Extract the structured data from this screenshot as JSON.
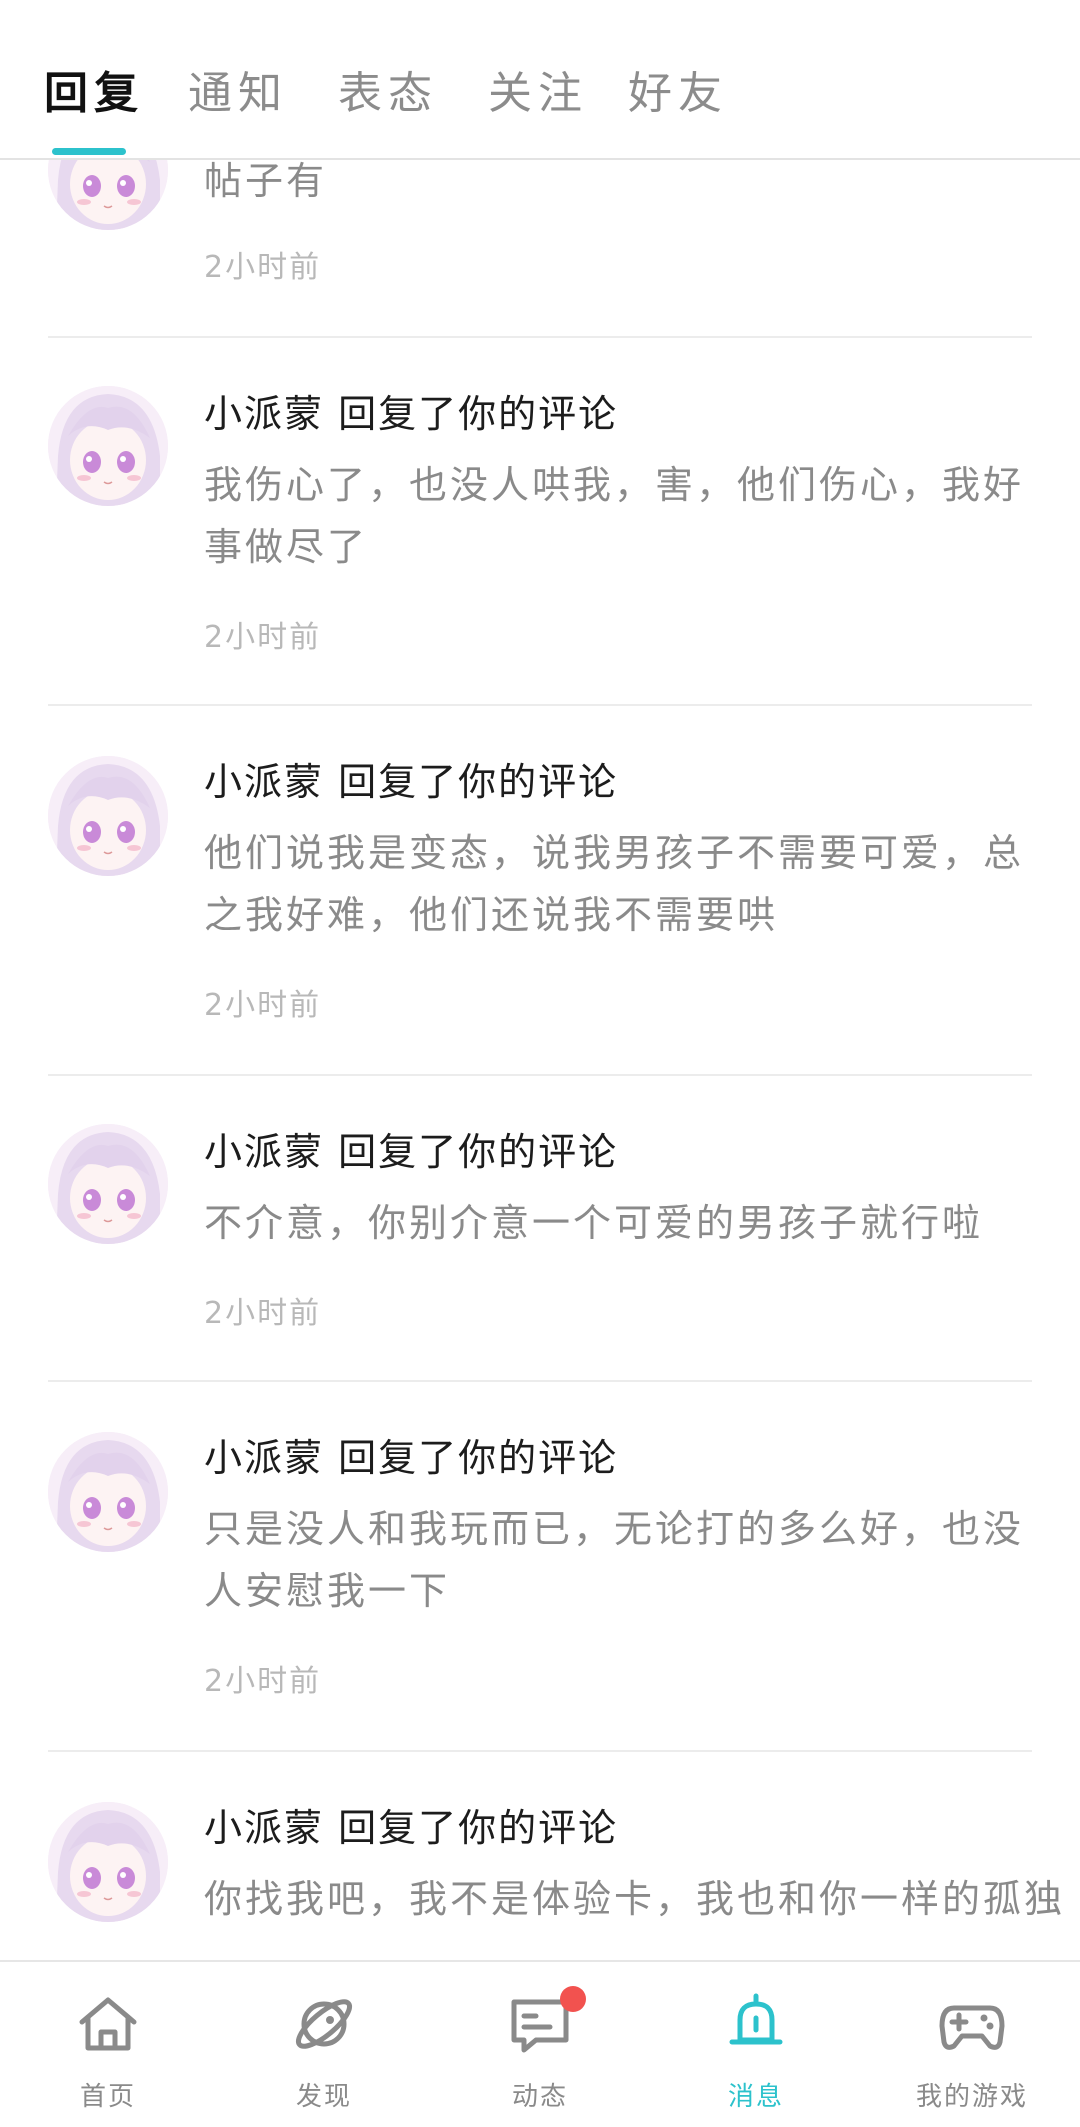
{
  "tabs": {
    "items": [
      {
        "label": "回复",
        "active": true
      },
      {
        "label": "通知",
        "active": false
      },
      {
        "label": "表态",
        "active": false
      },
      {
        "label": "关注",
        "active": false
      },
      {
        "label": "好友",
        "active": false
      }
    ],
    "indicator_color": "#2cc2cc"
  },
  "messages": [
    {
      "title": "",
      "body": "帖子有",
      "time": "2小时前",
      "avatar": "anime-girl-avatar"
    },
    {
      "title": "小派蒙 回复了你的评论",
      "body": "我伤心了，也没人哄我，害，他们伤心，我好事做尽了",
      "time": "2小时前",
      "avatar": "anime-girl-avatar"
    },
    {
      "title": "小派蒙 回复了你的评论",
      "body": "他们说我是变态，说我男孩子不需要可爱，总之我好难，他们还说我不需要哄",
      "time": "2小时前",
      "avatar": "anime-girl-avatar"
    },
    {
      "title": "小派蒙 回复了你的评论",
      "body": "不介意，你别介意一个可爱的男孩子就行啦",
      "time": "2小时前",
      "avatar": "anime-girl-avatar"
    },
    {
      "title": "小派蒙 回复了你的评论",
      "body": "只是没人和我玩而已，无论打的多么好，也没人安慰我一下",
      "time": "2小时前",
      "avatar": "anime-girl-avatar"
    },
    {
      "title": "小派蒙 回复了你的评论",
      "body": "你找我吧，我不是体验卡，我也和你一样的孤独",
      "time": "",
      "avatar": "anime-girl-avatar"
    }
  ],
  "bottom_nav": {
    "items": [
      {
        "label": "首页",
        "icon": "home-icon",
        "active": false
      },
      {
        "label": "发现",
        "icon": "planet-icon",
        "active": false
      },
      {
        "label": "动态",
        "icon": "chat-icon",
        "active": false,
        "badge": true
      },
      {
        "label": "消息",
        "icon": "bell-icon",
        "active": true
      },
      {
        "label": "我的游戏",
        "icon": "gamepad-icon",
        "active": false
      }
    ],
    "active_color": "#2cc2cc",
    "badge_color": "#f2524f"
  }
}
